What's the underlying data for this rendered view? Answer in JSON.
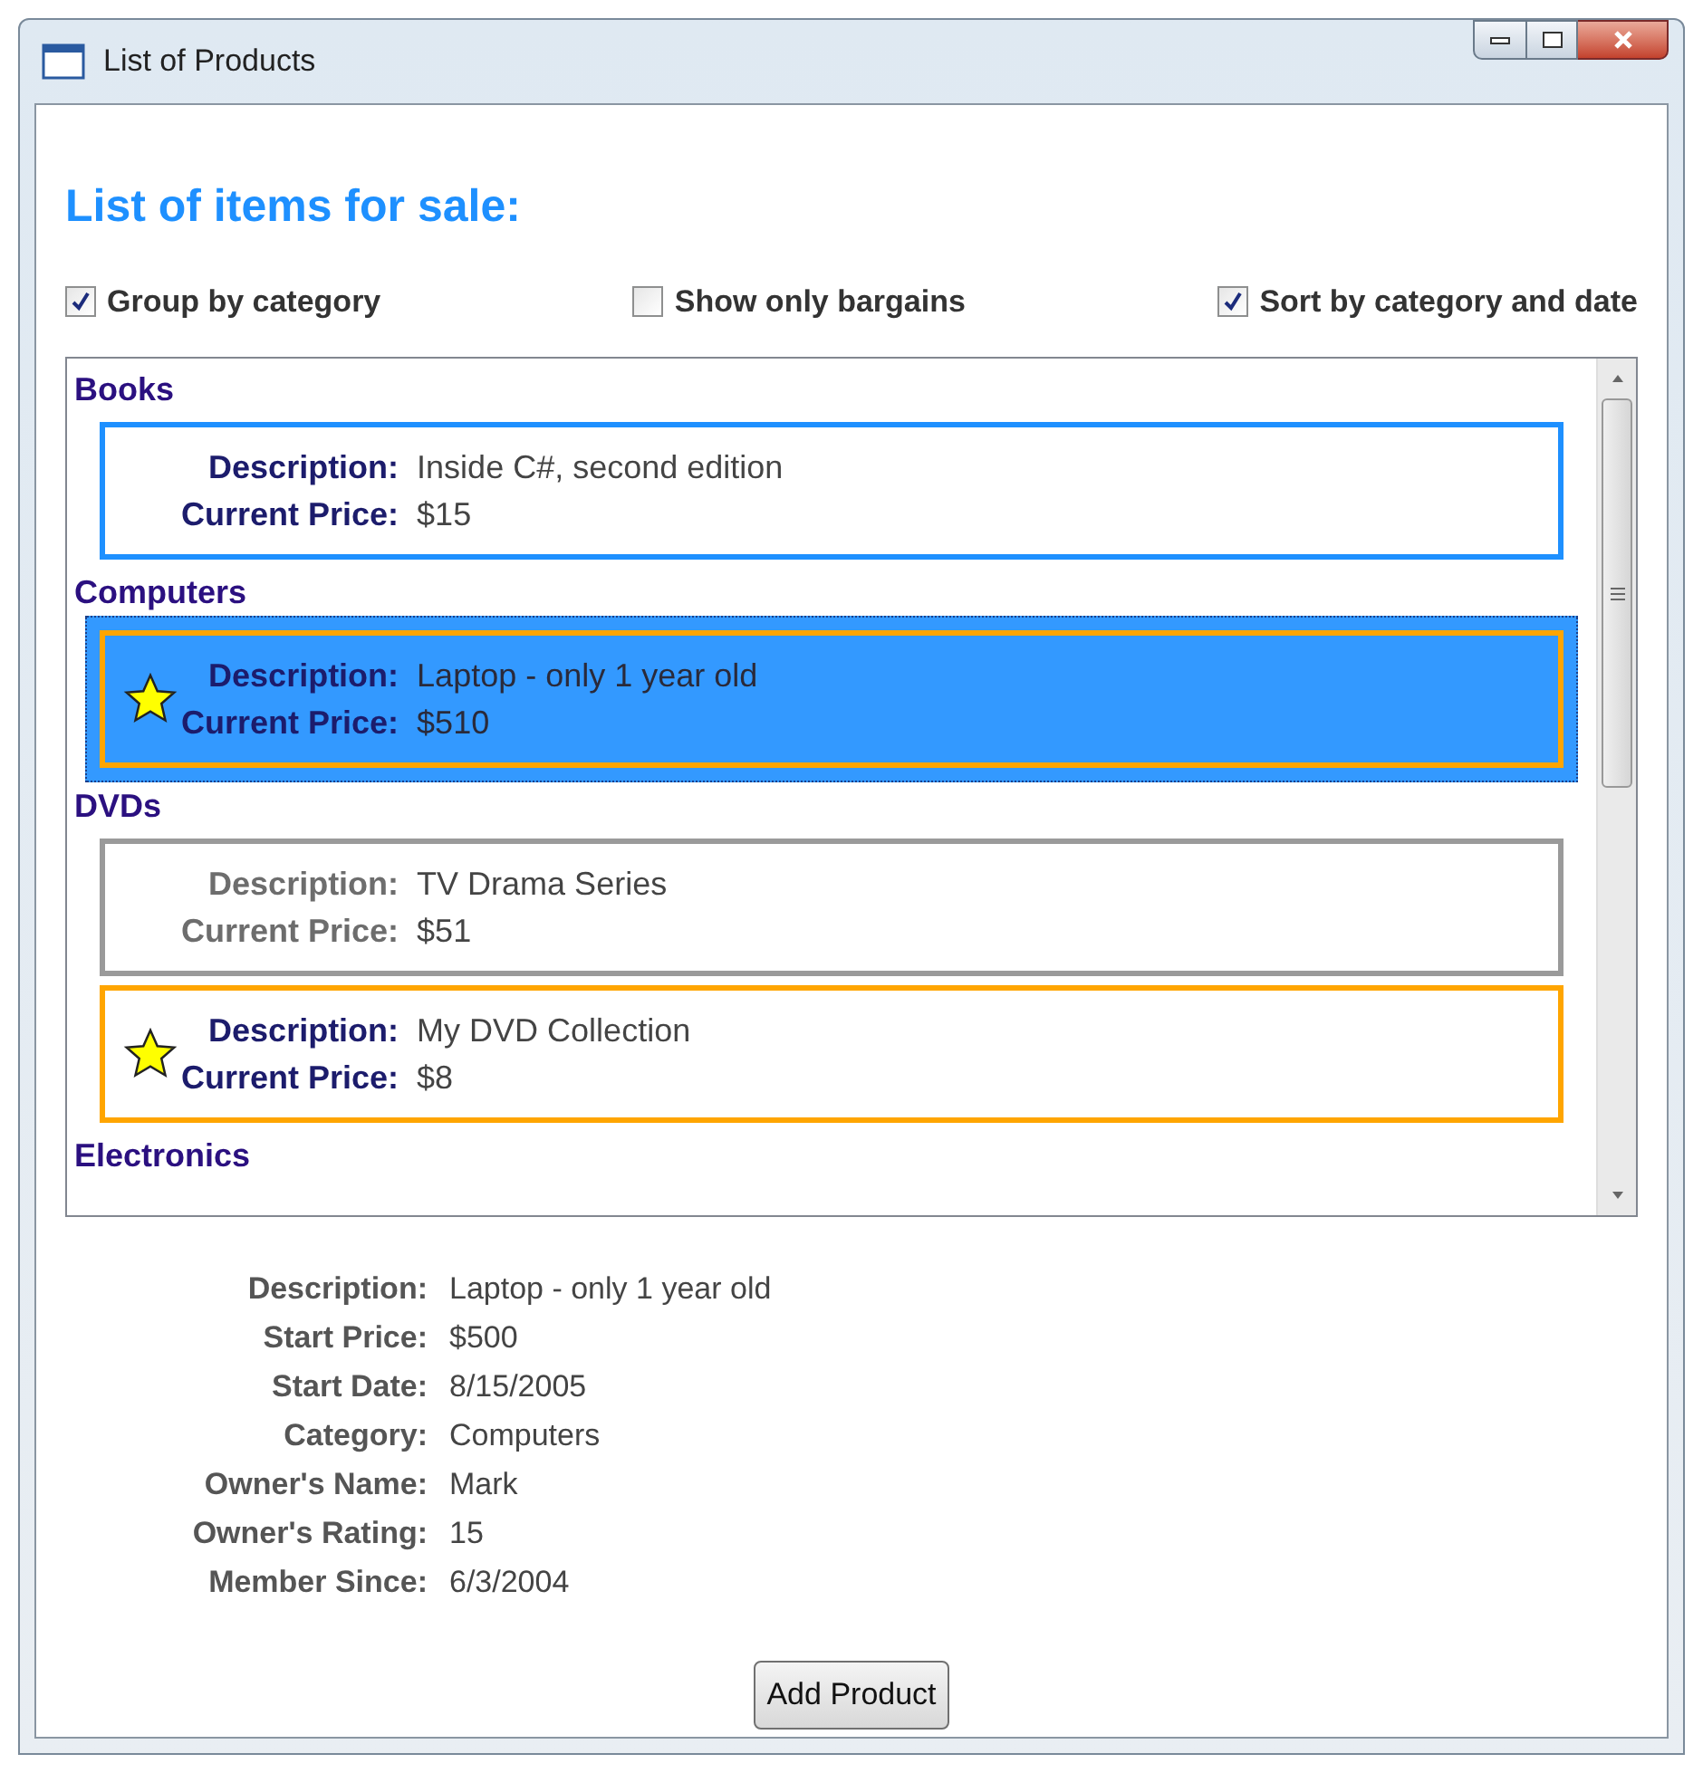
{
  "window": {
    "title": "List of Products"
  },
  "heading": "List of items for sale:",
  "options": [
    {
      "label": "Group by category",
      "checked": true
    },
    {
      "label": "Show only bargains",
      "checked": false
    },
    {
      "label": "Sort by category and date",
      "checked": true
    }
  ],
  "groups": [
    {
      "name": "Books",
      "items": [
        {
          "kind": "color",
          "selected": false,
          "fields": [
            {
              "label": "Description:",
              "value": "Inside C#, second edition"
            },
            {
              "label": "Current Price:",
              "value": "$15"
            }
          ]
        }
      ]
    },
    {
      "name": "Computers",
      "items": [
        {
          "kind": "highlight",
          "selected": true,
          "fields": [
            {
              "label": "Description:",
              "value": "Laptop - only 1 year old"
            },
            {
              "label": "Current Price:",
              "value": "$510"
            }
          ]
        }
      ]
    },
    {
      "name": "DVDs",
      "items": [
        {
          "kind": "plain",
          "selected": false,
          "fields": [
            {
              "label": "Description:",
              "value": "TV Drama Series"
            },
            {
              "label": "Current Price:",
              "value": "$51"
            }
          ]
        },
        {
          "kind": "highlight",
          "selected": false,
          "fields": [
            {
              "label": "Description:",
              "value": "My DVD Collection"
            },
            {
              "label": "Current Price:",
              "value": "$8"
            }
          ]
        }
      ]
    },
    {
      "name": "Electronics"
    }
  ],
  "details": [
    {
      "label": "Description:",
      "value": "Laptop - only 1 year old"
    },
    {
      "label": "Start Price:",
      "value": "$500"
    },
    {
      "label": "Start Date:",
      "value": "8/15/2005"
    },
    {
      "label": "Category:",
      "value": "Computers"
    },
    {
      "label": "Owner's Name:",
      "value": "Mark"
    },
    {
      "label": "Owner's Rating:",
      "value": "15"
    },
    {
      "label": "Member Since:",
      "value": "6/3/2004"
    }
  ],
  "button": "Add Product"
}
